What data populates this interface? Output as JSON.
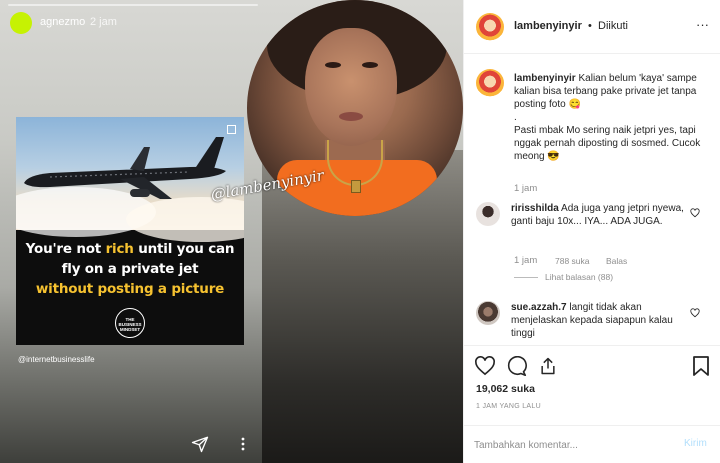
{
  "story": {
    "username": "agnezmo",
    "time": "2 jam",
    "card_headline_1": "You're not",
    "card_headline_rich": "rich",
    "card_headline_2": "until you can fly on a private jet",
    "card_headline_3": "without posting a picture",
    "card_logo": "THE BUSINESS MINDSET",
    "card_credit": "@internetbusinesslife",
    "watermark": "@lambenyinyir",
    "icons": [
      "send-icon",
      "more-vertical-icon"
    ],
    "avatar_color": "#c6f203",
    "highlight_color": "#f6c230"
  },
  "post": {
    "header": {
      "username": "lambenyinyir",
      "separator": "•",
      "follow_status": "Diikuti",
      "more": "···"
    },
    "caption": {
      "username": "lambenyinyir",
      "line1": "Kalian belum 'kaya' sampe kalian bisa terbang pake private jet tanpa posting foto 😋",
      "line2": ".",
      "line3": "Pasti mbak Mo sering naik jetpri yes, tapi nggak pernah diposting di sosmed. Cucok meong 😎",
      "time": "1 jam"
    },
    "comments": [
      {
        "username": "ririsshilda",
        "text": "Ada juga yang jetpri nyewa, ganti baju 10x... IYA... ADA JUGA.",
        "time": "1 jam",
        "likes": "788 suka",
        "reply": "Balas",
        "view_replies": "Lihat balasan (88)"
      },
      {
        "username": "sue.azzah.7",
        "text": "langit tidak akan menjelaskan kepada siapapun kalau tinggi"
      }
    ],
    "likes": "19,062 suka",
    "posted_ago": "1 JAM YANG LALU",
    "comment_placeholder": "Tambahkan komentar...",
    "post_button": "Kirim",
    "accent_color": "#b2dffc"
  }
}
